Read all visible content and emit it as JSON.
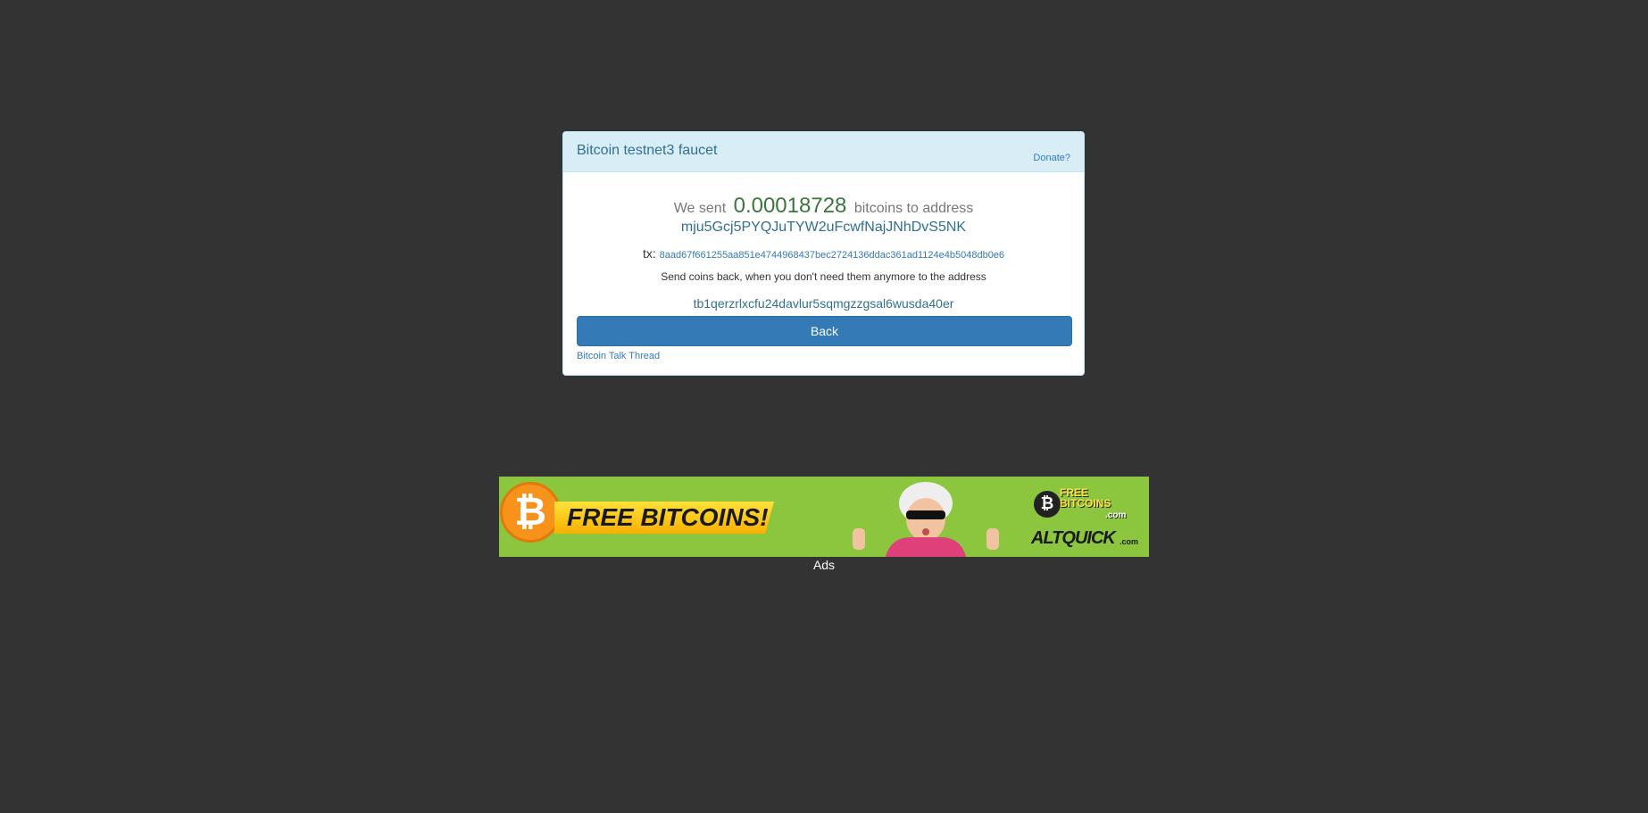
{
  "panel": {
    "title": "Bitcoin testnet3 faucet",
    "donate_label": "Donate?"
  },
  "result": {
    "we_sent": "We sent",
    "amount": "0.00018728",
    "to_address_text": "bitcoins to address",
    "address": "mju5Gcj5PYQJuTYW2uFcwfNajJNhDvS5NK",
    "tx_label": "tx:",
    "tx_hash": "8aad67f661255aa851e4744968437bec2724136ddac361ad1124e4b5048db0e6",
    "send_back_text": "Send coins back, when you don't need them anymore to the address",
    "return_address": "tb1qerzrlxcfu24davlur5sqmgzzgsal6wusda40er"
  },
  "actions": {
    "back_label": "Back",
    "thread_label": "Bitcoin Talk Thread"
  },
  "ad": {
    "headline": "FREE BITCOINS!",
    "brand_line1": "FREE",
    "brand_line2": "BITCOINS",
    "brand_sub": ".com",
    "altquick": "ALTQUICK",
    "altquick_com": ".com",
    "label": "Ads"
  },
  "colors": {
    "background": "#333333",
    "panel_heading": "#d9edf7",
    "amount_green": "#3c763d",
    "primary_button": "#337ab7",
    "ad_green": "#8cc63f",
    "bitcoin_orange": "#f7931a"
  },
  "icons": {
    "ad_coin": "bitcoin-icon"
  }
}
